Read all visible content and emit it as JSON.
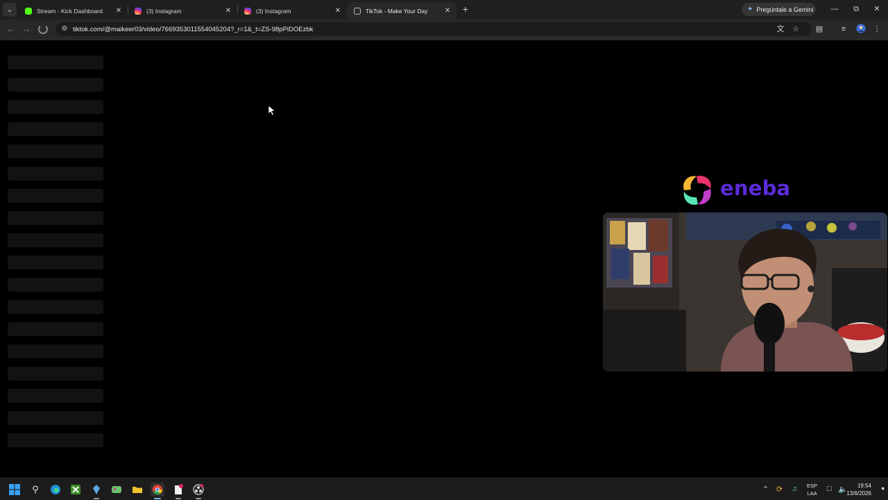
{
  "tabs": [
    {
      "title": "Stream - Kick Dashboard",
      "favicon": "kick-icon"
    },
    {
      "title": "(3) Instagram",
      "favicon": "instagram-icon"
    },
    {
      "title": "(3) Instagram",
      "favicon": "instagram-icon"
    },
    {
      "title": "TikTok - Make Your Day",
      "favicon": "tiktok-icon",
      "active": true
    }
  ],
  "gemini_button": "Pregúntale a Gemini",
  "omnibox": {
    "url": "tiktok.com/@maikeer03/video/7669353011554045204?_r=1&_t=ZS-98pPiDOEzbk"
  },
  "overlay": {
    "brand_text": "eneba",
    "brand_color": "#5b2bd9"
  },
  "taskbar": {
    "language": "ESP",
    "layout": "LAA",
    "time": "19:54",
    "date": "13/8/2026"
  },
  "colors": {
    "tabstrip": "#1f1f1f",
    "toolbar": "#282828",
    "page_background": "#000000",
    "skeleton": "#121212"
  }
}
